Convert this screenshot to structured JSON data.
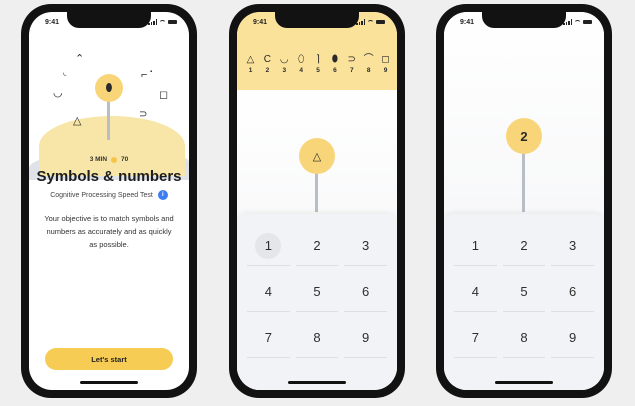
{
  "status": {
    "time": "9:41"
  },
  "screen1": {
    "duration": "3 MIN",
    "points": "70",
    "title": "Symbols & numbers",
    "subtitle": "Cognitive Processing Speed Test",
    "info": "i",
    "description": "Your objective is to match symbols and numbers as accurately and as quickly as possible.",
    "start_label": "Let's start",
    "pin_symbol": "⬮",
    "floating_symbols": [
      "◡",
      "⌃",
      "◟",
      "◻",
      "△",
      "⊃",
      "⌐",
      "⋅"
    ]
  },
  "screen2": {
    "key": [
      {
        "symbol": "△",
        "number": "1"
      },
      {
        "symbol": "C",
        "number": "2"
      },
      {
        "symbol": "◡",
        "number": "3"
      },
      {
        "symbol": "⬯",
        "number": "4"
      },
      {
        "symbol": "⌉",
        "number": "5"
      },
      {
        "symbol": "⬮",
        "number": "6"
      },
      {
        "symbol": "⊃",
        "number": "7"
      },
      {
        "symbol": "⌒",
        "number": "8"
      },
      {
        "symbol": "◻",
        "number": "9"
      }
    ],
    "prompt_symbol": "△",
    "keys": [
      "1",
      "2",
      "3",
      "4",
      "5",
      "6",
      "7",
      "8",
      "9"
    ]
  },
  "screen3": {
    "prompt_number": "2",
    "keys": [
      "1",
      "2",
      "3",
      "4",
      "5",
      "6",
      "7",
      "8",
      "9"
    ]
  }
}
